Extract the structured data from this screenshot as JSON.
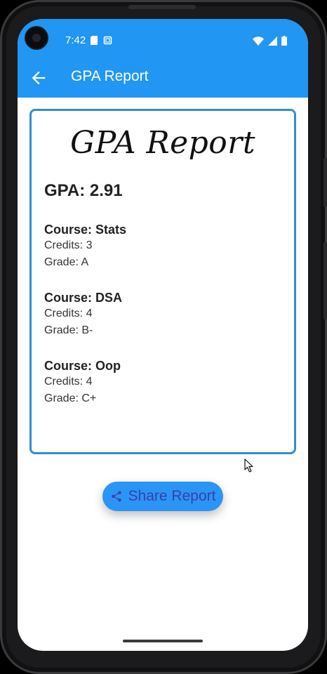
{
  "status_bar": {
    "time": "7:42",
    "icons_left": [
      "sd-card-icon",
      "screenshot-icon"
    ],
    "icons_right": [
      "wifi-icon",
      "signal-icon",
      "battery-icon"
    ],
    "color": "#2196f3"
  },
  "app_bar": {
    "title": "GPA Report",
    "back_icon": "arrow-back-icon"
  },
  "report": {
    "heading": "GPA Report",
    "gpa": "GPA: 2.91",
    "border_color": "#2f8fd4",
    "courses": [
      {
        "name": "Course: Stats",
        "credits": "Credits: 3",
        "grade": "Grade: A"
      },
      {
        "name": "Course: DSA",
        "credits": "Credits: 4",
        "grade": "Grade: B-"
      },
      {
        "name": "Course: Oop",
        "credits": "Credits: 4",
        "grade": "Grade: C+"
      }
    ]
  },
  "share_button": {
    "label": "Share Report",
    "icon": "share-icon",
    "color": "#2b95f5"
  }
}
